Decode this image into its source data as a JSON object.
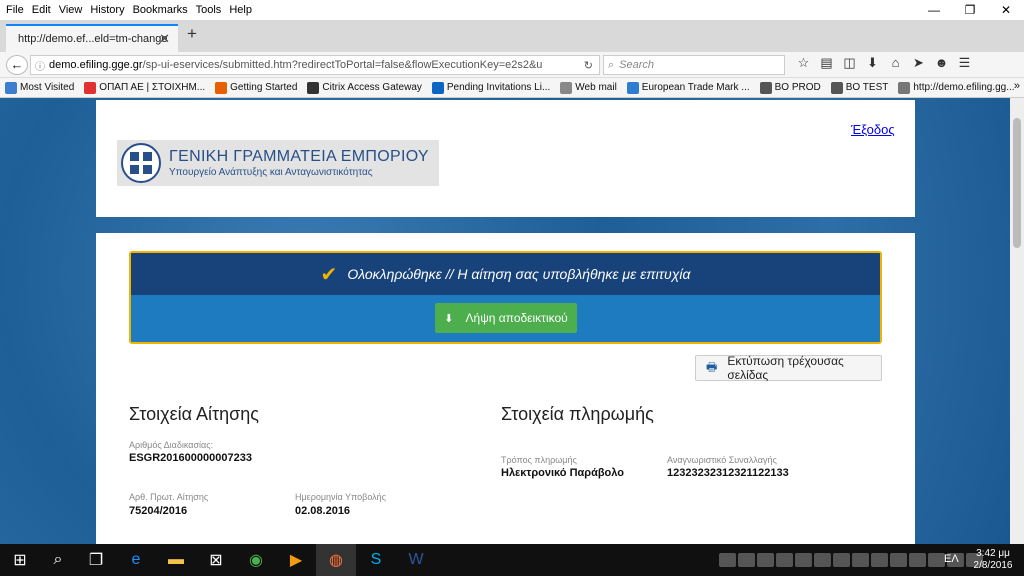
{
  "menubar": {
    "items": [
      "File",
      "Edit",
      "View",
      "History",
      "Bookmarks",
      "Tools",
      "Help"
    ]
  },
  "window_controls": {
    "minimize": "—",
    "restore": "❐",
    "close": "✕"
  },
  "tab": {
    "title": "http://demo.ef...eld=tm-change",
    "close": "✕",
    "new_tab": "+"
  },
  "navbar": {
    "url_host": "demo.efiling.gge.gr",
    "url_rest": "/sp-ui-eservices/submitted.htm?redirectToPortal=false&flowExecutionKey=e2s2&u",
    "search_placeholder": "Search"
  },
  "bookmarks": [
    {
      "label": "Most Visited",
      "color": "#3c7fd1"
    },
    {
      "label": "ΟΠΑΠ ΑΕ | ΣΤΟΙΧΗΜ...",
      "color": "#e03030"
    },
    {
      "label": "Getting Started",
      "color": "#e66000"
    },
    {
      "label": "Citrix Access Gateway",
      "color": "#333333"
    },
    {
      "label": "Pending Invitations Li...",
      "color": "#0a66c2"
    },
    {
      "label": "Web mail",
      "color": "#888888"
    },
    {
      "label": "European Trade Mark ...",
      "color": "#2d7dd2"
    },
    {
      "label": "BO PROD",
      "color": "#555555"
    },
    {
      "label": "BO TEST",
      "color": "#555555"
    },
    {
      "label": "http://demo.efiling.gg...",
      "color": "#777777"
    }
  ],
  "header": {
    "logo_title": "ΓΕΝΙΚΗ ΓΡΑΜΜΑΤΕΙΑ ΕΜΠΟΡΙΟΥ",
    "logo_subtitle": "Υπουργείο Ανάπτυξης και Ανταγωνιστικότητας",
    "logout": "Έξοδος"
  },
  "banner": {
    "message": "Ολοκληρώθηκε // Η αίτηση σας υποβλήθηκε με επιτυχία",
    "download_button": "Λήψη αποδεικτικού"
  },
  "print_button": "Εκτύπωση τρέχουσας σελίδας",
  "application": {
    "title": "Στοιχεία Αίτησης",
    "procedure_label": "Αριθμός Διαδικασίας:",
    "procedure_value": "ESGR201600000007233",
    "protocol_label": "Αρθ. Πρωτ. Αίτησης",
    "protocol_value": "75204/2016",
    "date_label": "Ημερομηνία Υποβολής",
    "date_value": "02.08.2016"
  },
  "payment": {
    "title": "Στοιχεία πληρωμής",
    "method_label": "Τρόπος πληρωμής",
    "method_value": "Ηλεκτρονικό Παράβολο",
    "transaction_label": "Αναγνωριστικό Συναλλαγής",
    "transaction_value": "12323232312321122133"
  },
  "taskbar": {
    "language": "ΕΛ",
    "time": "3:42 μμ",
    "date": "2/8/2016"
  }
}
